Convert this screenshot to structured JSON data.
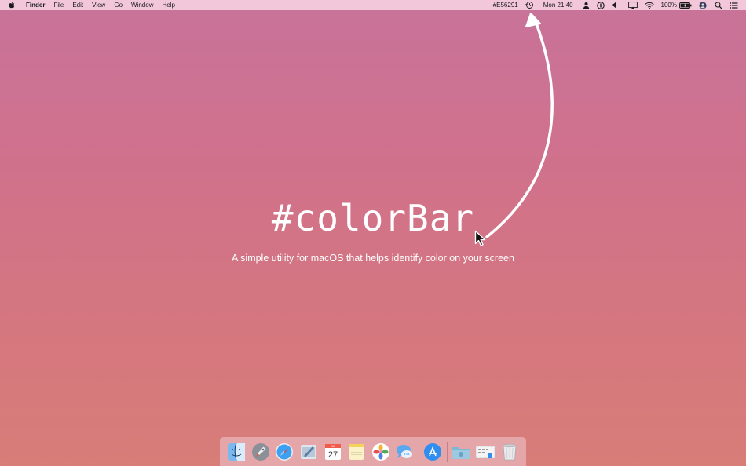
{
  "menubar": {
    "app_name": "Finder",
    "menus": [
      "File",
      "Edit",
      "View",
      "Go",
      "Window",
      "Help"
    ],
    "color_hex": "#E56291",
    "clock": "Mon 21:40",
    "battery": "100%"
  },
  "main": {
    "title": "#colorBar",
    "subtitle": "A simple utility for macOS that helps identify color on your screen"
  },
  "calendar": {
    "day": "27",
    "month": "JUL"
  },
  "colors": {
    "sampled": "#E56291",
    "background_top": "#c8739a",
    "background_bottom": "#d87d78"
  },
  "dock": {
    "items": [
      "finder-icon",
      "launchpad-icon",
      "safari-icon",
      "mail-icon",
      "calendar-icon",
      "notes-icon",
      "photos-icon",
      "messages-icon",
      "app-store-icon",
      "downloads-folder-icon",
      "screenshot-icon",
      "trash-icon"
    ]
  }
}
